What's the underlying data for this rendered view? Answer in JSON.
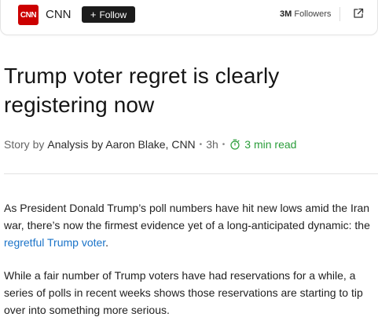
{
  "publisher": {
    "logo_text": "CNN",
    "name": "CNN",
    "follow_label": "Follow",
    "followers_count": "3M",
    "followers_label": "Followers",
    "brand_color": "#cc0000"
  },
  "article": {
    "headline": "Trump voter regret is clearly registering now",
    "byline": {
      "prefix": "Story by",
      "author": "Analysis by Aaron Blake, CNN",
      "age": "3h",
      "read_time": "3 min read"
    },
    "paragraphs": [
      {
        "before": "As President Donald Trump’s poll numbers have hit new lows amid the Iran war, there’s now the firmest evidence yet of a long-anticipated dynamic: the ",
        "link": "regretful Trump voter",
        "after": "."
      },
      {
        "text": "While a fair number of Trump voters have had reservations for a while, a series of polls in recent weeks shows those reservations are starting to tip over into something more serious."
      }
    ]
  },
  "colors": {
    "link": "#1a73c8",
    "read_time": "#2a9d3a"
  },
  "icons": {
    "share": "share-external-icon",
    "stopwatch": "stopwatch-icon"
  }
}
